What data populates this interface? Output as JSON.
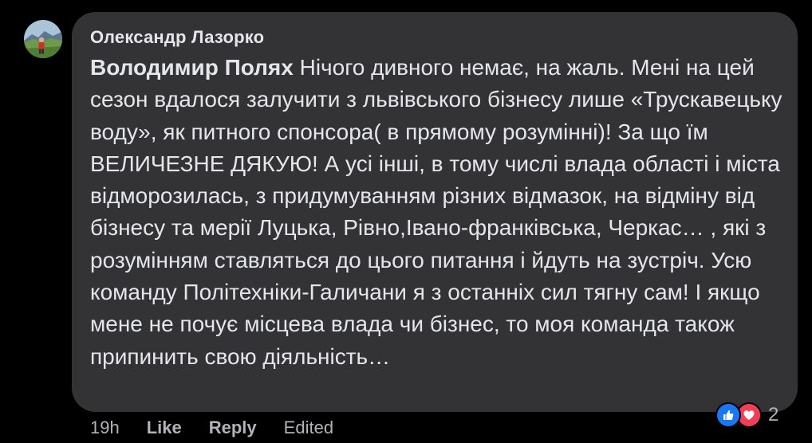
{
  "comment": {
    "author": "Олександр Лазорко",
    "mention": "Володимир Полях",
    "text": " Нічого дивного немає, на жаль. Мені на цей сезон вдалося залучити з львівського бізнесу лише «Трускавецьку воду», як питного спонсора( в прямому розумінні)! За що їм ВЕЛИЧЕЗНЕ ДЯКУЮ! А усі інші, в тому числі влада області і міста відморозилась, з придумуванням різних відмазок, на відміну від бізнесу та мерії Луцька, Рівно,Івано-франківська, Черкас… , які з розумінням ставляться до цього питання і йдуть на зустріч. Усю команду Політехніки-Галичани я з останніх сил тягну сам! І якщо мене не почує місцева влада чи бізнес, то моя команда також припинить свою діяльність…"
  },
  "meta": {
    "time": "19h",
    "like_label": "Like",
    "reply_label": "Reply",
    "edited_label": "Edited"
  },
  "reactions": {
    "types": [
      "like-icon",
      "love-icon"
    ],
    "count": "2",
    "colors": {
      "like": "#1877f2",
      "love": "#f33e58"
    }
  },
  "colors": {
    "background": "#000000",
    "bubble": "#333335",
    "text": "#e4e6eb",
    "secondary_text": "#b0b3b8"
  }
}
